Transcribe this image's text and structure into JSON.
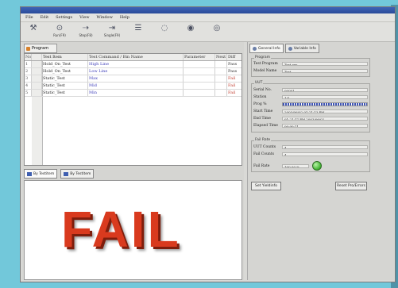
{
  "menu": [
    "File",
    "Edit",
    "Settings",
    "View",
    "Window",
    "Help"
  ],
  "toolbar": [
    {
      "label": "",
      "icon": "wrench-icon"
    },
    {
      "label": "Run(F9)",
      "icon": "run-icon"
    },
    {
      "label": "Step(F8)",
      "icon": "step-icon"
    },
    {
      "label": "Single(F9)",
      "icon": "single-icon"
    },
    {
      "label": "",
      "icon": "list-icon"
    },
    {
      "label": "",
      "icon": "circle-icon"
    },
    {
      "label": "",
      "icon": "stop-icon"
    },
    {
      "label": "",
      "icon": "record-icon"
    }
  ],
  "left": {
    "tab_label": "Program",
    "columns": [
      "No.",
      "",
      "Test Item",
      "Test Command / Bin Name",
      "Parameter",
      "Next",
      "Diff"
    ],
    "rows": [
      {
        "no": "1",
        "item": "Hold_On_Test",
        "cmd": "High Line",
        "diff": "Pass"
      },
      {
        "no": "2",
        "item": "Hold_On_Test",
        "cmd": "Low Line",
        "diff": "Pass"
      },
      {
        "no": "3",
        "item": "Static_Test",
        "cmd": "Max",
        "diff": "Fail"
      },
      {
        "no": "4",
        "item": "Static_Test",
        "cmd": "Mid",
        "diff": "Fail"
      },
      {
        "no": "5",
        "item": "Static_Test",
        "cmd": "Min",
        "diff": "Fail"
      }
    ],
    "bottom_tabs": [
      "By Testitem",
      "By Testitem"
    ],
    "result_text": "FAIL"
  },
  "right": {
    "tabs": [
      "General Info",
      "Variable Info"
    ],
    "program_group": {
      "title": "Program",
      "fields": [
        {
          "label": "Test Program",
          "value": "Test ary"
        },
        {
          "label": "Model Name",
          "value": "Test"
        }
      ]
    },
    "uut_group": {
      "title": "UUT",
      "fields": [
        {
          "label": "Serial No.",
          "value": "00001"
        },
        {
          "label": "Station",
          "value": "1/1"
        },
        {
          "label": "Start Time",
          "value": "2003/06/02 01:21:13 PM"
        },
        {
          "label": "End Time",
          "value": "01:21:17 PM 2003/06/02"
        },
        {
          "label": "Elapsed Time",
          "value": "00:00:11"
        }
      ],
      "progress_label": "Prog %",
      "progress": 1.0
    },
    "fail_group": {
      "title": "Fail Rate",
      "fields": [
        {
          "label": "UUT Counts",
          "value": "4"
        },
        {
          "label": "Fail Counts",
          "value": "4"
        }
      ],
      "rate_label": "Fail Rate",
      "rate_value": "100.00 %"
    },
    "buttons": [
      "Set Yieldinfo",
      "Reset Pro/Errors"
    ]
  }
}
